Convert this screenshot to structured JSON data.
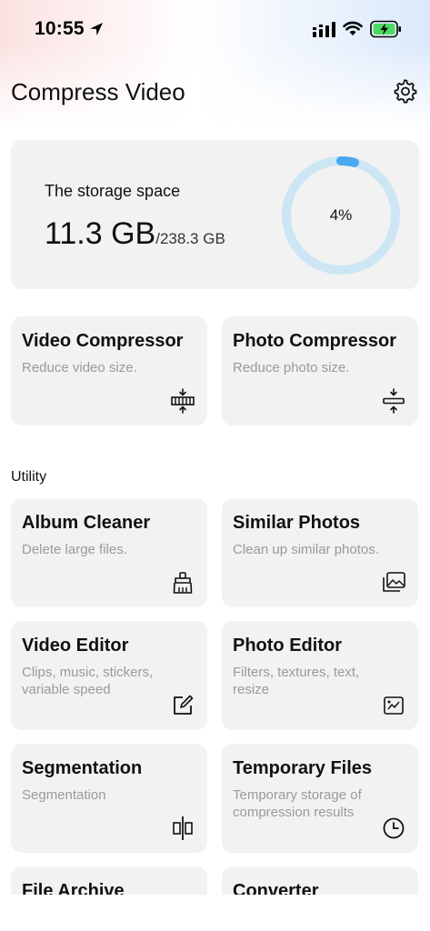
{
  "status": {
    "time": "10:55"
  },
  "header": {
    "title": "Compress Video"
  },
  "storage": {
    "label": "The storage space",
    "used": "11.3 GB",
    "total": "/238.3 GB",
    "percent_text": "4%",
    "percent": 0.04
  },
  "main_tools": [
    {
      "title": "Video Compressor",
      "desc": "Reduce video size.",
      "icon": "video-compress-icon"
    },
    {
      "title": "Photo Compressor",
      "desc": "Reduce photo size.",
      "icon": "photo-compress-icon"
    }
  ],
  "utility": {
    "label": "Utility",
    "items": [
      {
        "title": "Album Cleaner",
        "desc": "Delete large files.",
        "icon": "broom-icon"
      },
      {
        "title": "Similar Photos",
        "desc": "Clean up similar photos.",
        "icon": "photos-stack-icon"
      },
      {
        "title": "Video Editor",
        "desc": "Clips, music, stickers, variable speed",
        "icon": "edit-icon"
      },
      {
        "title": "Photo Editor",
        "desc": "Filters, textures, text, resize",
        "icon": "image-edit-icon"
      },
      {
        "title": "Segmentation",
        "desc": "Segmentation",
        "icon": "split-icon"
      },
      {
        "title": "Temporary Files",
        "desc": "Temporary storage of compression results",
        "icon": "clock-icon"
      },
      {
        "title": "File Archive",
        "desc": "",
        "icon": ""
      },
      {
        "title": "Converter",
        "desc": "",
        "icon": ""
      }
    ]
  },
  "colors": {
    "ring_track": "#cde6f4",
    "ring_fill": "#4aa8f0",
    "card_bg": "#f2f2f2",
    "desc_gray": "#9a9a9a"
  }
}
